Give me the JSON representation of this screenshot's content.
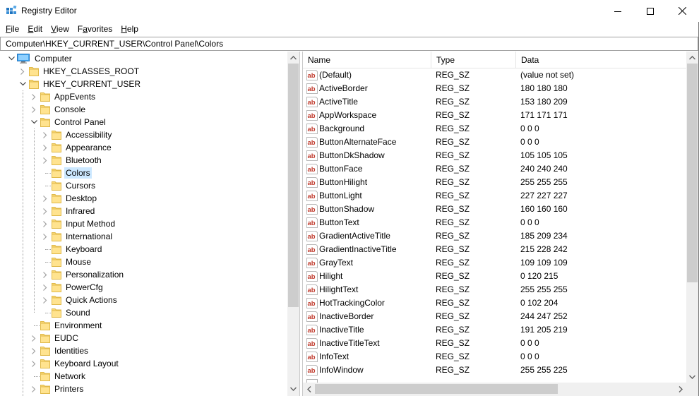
{
  "window": {
    "title": "Registry Editor",
    "controls": {
      "minimize": "minimize",
      "maximize": "maximize",
      "close": "close"
    }
  },
  "menu": [
    {
      "label": "File",
      "mnemonic": "F",
      "rest": "ile"
    },
    {
      "label": "Edit",
      "mnemonic": "E",
      "rest": "dit"
    },
    {
      "label": "View",
      "mnemonic": "V",
      "rest": "iew"
    },
    {
      "label": "Favorites",
      "pre": "F",
      "mnemonic": "a",
      "rest": "vorites"
    },
    {
      "label": "Help",
      "mnemonic": "H",
      "rest": "elp"
    }
  ],
  "address": {
    "path": "Computer\\HKEY_CURRENT_USER\\Control Panel\\Colors"
  },
  "tree": {
    "items": [
      {
        "label": "Computer",
        "level": 0,
        "expander": "expanded",
        "icon": "computer-icon"
      },
      {
        "label": "HKEY_CLASSES_ROOT",
        "level": 1,
        "expander": "collapsed",
        "icon": "folder-icon"
      },
      {
        "label": "HKEY_CURRENT_USER",
        "level": 1,
        "expander": "expanded",
        "icon": "folder-icon"
      },
      {
        "label": "AppEvents",
        "level": 2,
        "expander": "collapsed",
        "icon": "folder-icon"
      },
      {
        "label": "Console",
        "level": 2,
        "expander": "collapsed",
        "icon": "folder-icon"
      },
      {
        "label": "Control Panel",
        "level": 2,
        "expander": "expanded",
        "icon": "folder-icon"
      },
      {
        "label": "Accessibility",
        "level": 3,
        "expander": "collapsed",
        "icon": "folder-icon"
      },
      {
        "label": "Appearance",
        "level": 3,
        "expander": "collapsed",
        "icon": "folder-icon"
      },
      {
        "label": "Bluetooth",
        "level": 3,
        "expander": "collapsed",
        "icon": "folder-icon"
      },
      {
        "label": "Colors",
        "level": 3,
        "expander": "none",
        "icon": "folder-icon",
        "selected": true
      },
      {
        "label": "Cursors",
        "level": 3,
        "expander": "none",
        "icon": "folder-icon"
      },
      {
        "label": "Desktop",
        "level": 3,
        "expander": "collapsed",
        "icon": "folder-icon"
      },
      {
        "label": "Infrared",
        "level": 3,
        "expander": "collapsed",
        "icon": "folder-icon"
      },
      {
        "label": "Input Method",
        "level": 3,
        "expander": "collapsed",
        "icon": "folder-icon"
      },
      {
        "label": "International",
        "level": 3,
        "expander": "collapsed",
        "icon": "folder-icon"
      },
      {
        "label": "Keyboard",
        "level": 3,
        "expander": "none",
        "icon": "folder-icon"
      },
      {
        "label": "Mouse",
        "level": 3,
        "expander": "none",
        "icon": "folder-icon"
      },
      {
        "label": "Personalization",
        "level": 3,
        "expander": "collapsed",
        "icon": "folder-icon"
      },
      {
        "label": "PowerCfg",
        "level": 3,
        "expander": "collapsed",
        "icon": "folder-icon"
      },
      {
        "label": "Quick Actions",
        "level": 3,
        "expander": "collapsed",
        "icon": "folder-icon"
      },
      {
        "label": "Sound",
        "level": 3,
        "expander": "none",
        "icon": "folder-icon"
      },
      {
        "label": "Environment",
        "level": 2,
        "expander": "none",
        "icon": "folder-icon"
      },
      {
        "label": "EUDC",
        "level": 2,
        "expander": "collapsed",
        "icon": "folder-icon"
      },
      {
        "label": "Identities",
        "level": 2,
        "expander": "collapsed",
        "icon": "folder-icon"
      },
      {
        "label": "Keyboard Layout",
        "level": 2,
        "expander": "collapsed",
        "icon": "folder-icon"
      },
      {
        "label": "Network",
        "level": 2,
        "expander": "none",
        "icon": "folder-icon"
      },
      {
        "label": "Printers",
        "level": 2,
        "expander": "collapsed",
        "icon": "folder-icon"
      }
    ]
  },
  "list": {
    "columns": [
      {
        "label": "Name"
      },
      {
        "label": "Type"
      },
      {
        "label": "Data"
      }
    ],
    "rows": [
      {
        "name": "(Default)",
        "type": "REG_SZ",
        "data": "(value not set)"
      },
      {
        "name": "ActiveBorder",
        "type": "REG_SZ",
        "data": "180 180 180"
      },
      {
        "name": "ActiveTitle",
        "type": "REG_SZ",
        "data": "153 180 209"
      },
      {
        "name": "AppWorkspace",
        "type": "REG_SZ",
        "data": "171 171 171"
      },
      {
        "name": "Background",
        "type": "REG_SZ",
        "data": "0 0 0"
      },
      {
        "name": "ButtonAlternateFace",
        "type": "REG_SZ",
        "data": "0 0 0"
      },
      {
        "name": "ButtonDkShadow",
        "type": "REG_SZ",
        "data": "105 105 105"
      },
      {
        "name": "ButtonFace",
        "type": "REG_SZ",
        "data": "240 240 240"
      },
      {
        "name": "ButtonHilight",
        "type": "REG_SZ",
        "data": "255 255 255"
      },
      {
        "name": "ButtonLight",
        "type": "REG_SZ",
        "data": "227 227 227"
      },
      {
        "name": "ButtonShadow",
        "type": "REG_SZ",
        "data": "160 160 160"
      },
      {
        "name": "ButtonText",
        "type": "REG_SZ",
        "data": "0 0 0"
      },
      {
        "name": "GradientActiveTitle",
        "type": "REG_SZ",
        "data": "185 209 234"
      },
      {
        "name": "GradientInactiveTitle",
        "type": "REG_SZ",
        "data": "215 228 242"
      },
      {
        "name": "GrayText",
        "type": "REG_SZ",
        "data": "109 109 109"
      },
      {
        "name": "Hilight",
        "type": "REG_SZ",
        "data": "0 120 215"
      },
      {
        "name": "HilightText",
        "type": "REG_SZ",
        "data": "255 255 255"
      },
      {
        "name": "HotTrackingColor",
        "type": "REG_SZ",
        "data": "0 102 204"
      },
      {
        "name": "InactiveBorder",
        "type": "REG_SZ",
        "data": "244 247 252"
      },
      {
        "name": "InactiveTitle",
        "type": "REG_SZ",
        "data": "191 205 219"
      },
      {
        "name": "InactiveTitleText",
        "type": "REG_SZ",
        "data": "0 0 0"
      },
      {
        "name": "InfoText",
        "type": "REG_SZ",
        "data": "0 0 0"
      },
      {
        "name": "InfoWindow",
        "type": "REG_SZ",
        "data": "255 255 225"
      }
    ]
  },
  "colors": {
    "selection": "#cce8ff",
    "scrollbar_track": "#f0f0f0",
    "scrollbar_thumb": "#cdcdcd",
    "folder": "#f8d775",
    "reg_sz_icon": "#c0392b"
  }
}
